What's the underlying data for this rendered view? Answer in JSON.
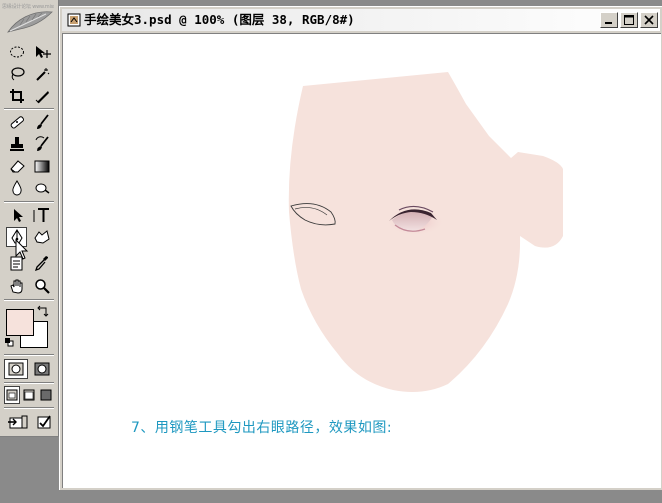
{
  "toolbox": {
    "watermark": "思缘设计论坛 www.missyuan.com",
    "tools": [
      {
        "name": "marquee-tool",
        "icon": "marquee-icon"
      },
      {
        "name": "move-tool",
        "icon": "move-icon"
      },
      {
        "name": "lasso-tool",
        "icon": "lasso-icon"
      },
      {
        "name": "magic-wand-tool",
        "icon": "magic-wand-icon"
      },
      {
        "name": "crop-tool",
        "icon": "crop-icon"
      },
      {
        "name": "slice-tool",
        "icon": "slice-icon"
      },
      {
        "name": "healing-brush-tool",
        "icon": "bandage-icon"
      },
      {
        "name": "brush-tool",
        "icon": "brush-icon"
      },
      {
        "name": "clone-stamp-tool",
        "icon": "stamp-icon"
      },
      {
        "name": "history-brush-tool",
        "icon": "history-brush-icon"
      },
      {
        "name": "eraser-tool",
        "icon": "eraser-icon"
      },
      {
        "name": "gradient-tool",
        "icon": "gradient-icon"
      },
      {
        "name": "blur-tool",
        "icon": "drop-icon"
      },
      {
        "name": "dodge-tool",
        "icon": "dodge-icon"
      },
      {
        "name": "path-selection-tool",
        "icon": "arrow-icon"
      },
      {
        "name": "type-tool",
        "icon": "type-icon"
      },
      {
        "name": "pen-tool",
        "icon": "pen-icon",
        "active": true
      },
      {
        "name": "custom-shape-tool",
        "icon": "shape-icon"
      },
      {
        "name": "notes-tool",
        "icon": "notes-icon"
      },
      {
        "name": "eyedropper-tool",
        "icon": "eyedropper-icon"
      },
      {
        "name": "hand-tool",
        "icon": "hand-icon"
      },
      {
        "name": "zoom-tool",
        "icon": "zoom-icon"
      }
    ],
    "foreground_color": "#f6e2dc",
    "background_color": "#ffffff"
  },
  "document": {
    "title": "手绘美女3.psd @ 100% (图层 38, RGB/8#)",
    "caption": "7、用钢笔工具勾出右眼路径，效果如图:",
    "skin_color": "#f6e2dc",
    "caption_color": "#1e98c0"
  }
}
